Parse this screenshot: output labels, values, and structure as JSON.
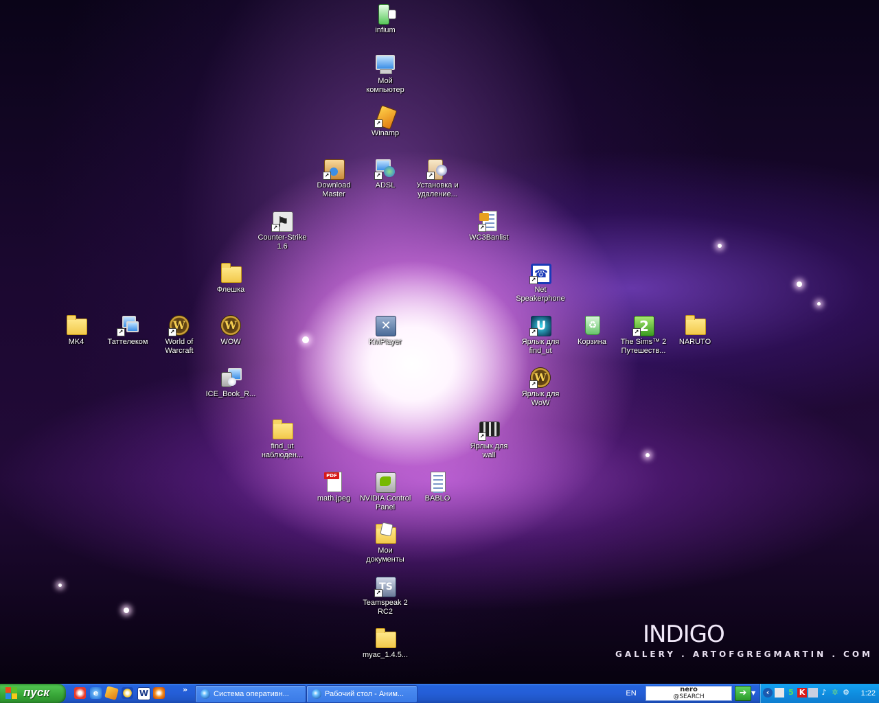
{
  "wallpaper": {
    "title": "INDIGO",
    "subtitle": "GALLERY . ARTOFGREGMARTIN . COM"
  },
  "icons": {
    "infium": "infium",
    "my_computer": "Мой компьютер",
    "winamp": "Winamp",
    "download_master": "Download Master",
    "adsl": "ADSL",
    "add_remove": "Установка и удаление...",
    "counter_strike": "Counter-Strike 1.6",
    "wc3banlist": "WC3Banlist",
    "fleshka": "Флешка",
    "net_speakerphone": "Net Speakerphone",
    "mk4": "MK4",
    "tattelecom": "Таттелеком",
    "world_of_warcraft": "World of Warcraft",
    "wow": "WOW",
    "kmplayer": "KMPlayer",
    "shortcut_find_ut": "Ярлык для find_ut",
    "recycle_bin": "Корзина",
    "sims2": "The Sims™ 2 Путешеств...",
    "naruto": "NARUTO",
    "ice_book": "ICE_Book_R...",
    "shortcut_wow": "Ярлык для WoW",
    "find_ut_folder": "find_ut наблюден...",
    "shortcut_wall": "Ярлык для wall",
    "math_jpeg": "math.jpeg",
    "nvidia": "NVIDIA Control Panel",
    "bablo": "BABLO",
    "my_documents": "Мои документы",
    "teamspeak": "Teamspeak 2 RC2",
    "myac": "myac_1.4.5..."
  },
  "taskbar": {
    "start_label": "пуск",
    "more_label": "»",
    "tasks": [
      {
        "label": "Система оперативн..."
      },
      {
        "label": "Рабочий стол - Аним..."
      }
    ],
    "language": "EN",
    "nero_brand": "nero",
    "nero_sub": "@SEARCH",
    "clock": "1:22"
  }
}
